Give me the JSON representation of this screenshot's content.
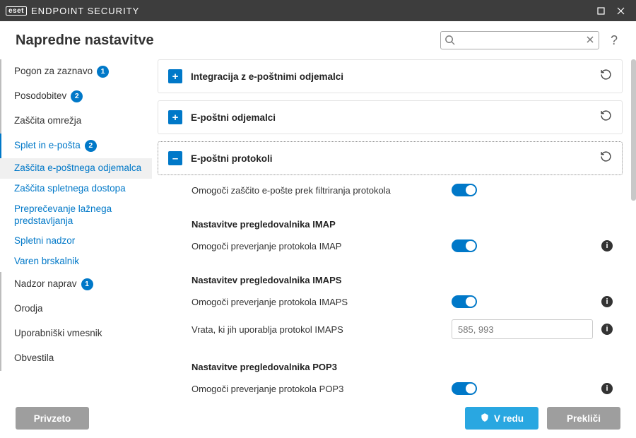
{
  "titlebar": {
    "brand": "eset",
    "product": "ENDPOINT SECURITY"
  },
  "header": {
    "title": "Napredne nastavitve",
    "search_placeholder": "",
    "help": "?"
  },
  "sidebar": {
    "items": [
      {
        "label": "Pogon za zaznavo",
        "badge": "1"
      },
      {
        "label": "Posodobitev",
        "badge": "2"
      },
      {
        "label": "Zaščita omrežja"
      },
      {
        "label": "Splet in e-pošta",
        "badge": "2",
        "active": true,
        "children": [
          {
            "label": "Zaščita e-poštnega odjemalca",
            "selected": true
          },
          {
            "label": "Zaščita spletnega dostopa"
          },
          {
            "label": "Preprečevanje lažnega predstavljanja"
          },
          {
            "label": "Spletni nadzor"
          },
          {
            "label": "Varen brskalnik"
          }
        ]
      },
      {
        "label": "Nadzor naprav",
        "badge": "1"
      },
      {
        "label": "Orodja"
      },
      {
        "label": "Uporabniški vmesnik"
      },
      {
        "label": "Obvestila"
      }
    ]
  },
  "panels": {
    "integration": {
      "title": "Integracija z e-poštnimi odjemalci"
    },
    "clients": {
      "title": "E-poštni odjemalci"
    },
    "protocols": {
      "title": "E-poštni protokoli",
      "enable_filter": "Omogoči zaščito e-pošte prek filtriranja protokola",
      "imap_heading": "Nastavitve pregledovalnika IMAP",
      "imap_enable": "Omogoči preverjanje protokola IMAP",
      "imaps_heading": "Nastavitev pregledovalnika IMAPS",
      "imaps_enable": "Omogoči preverjanje protokola IMAPS",
      "imaps_ports_label": "Vrata, ki jih uporablja protokol IMAPS",
      "imaps_ports_value": "585, 993",
      "pop3_heading": "Nastavitve pregledovalnika POP3",
      "pop3_enable": "Omogoči preverjanje protokola POP3"
    }
  },
  "footer": {
    "default": "Privzeto",
    "ok": "V redu",
    "cancel": "Prekliči"
  }
}
